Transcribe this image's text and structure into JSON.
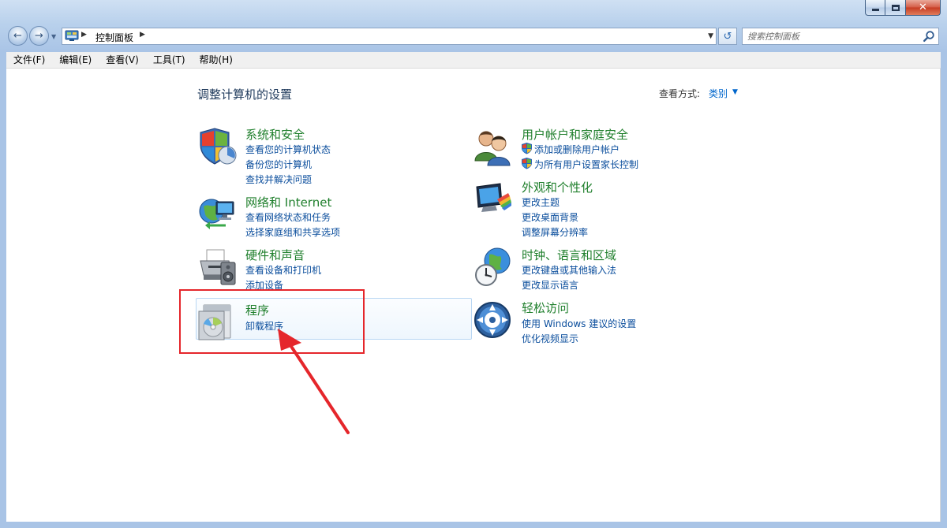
{
  "window": {
    "close_glyph": "✕"
  },
  "nav": {
    "back_glyph": "←",
    "forward_glyph": "→",
    "address": "控制面板",
    "search_placeholder": "搜索控制面板",
    "refresh_glyph": "↺"
  },
  "menu": [
    "文件(F)",
    "编辑(E)",
    "查看(V)",
    "工具(T)",
    "帮助(H)"
  ],
  "page": {
    "title": "调整计算机的设置",
    "view_by_label": "查看方式:",
    "view_by_value": "类别"
  },
  "categories": [
    {
      "title": "系统和安全",
      "links": [
        "查看您的计算机状态",
        "备份您的计算机",
        "查找并解决问题"
      ],
      "icon": "shield-icon"
    },
    {
      "title": "网络和 Internet",
      "links": [
        "查看网络状态和任务",
        "选择家庭组和共享选项"
      ],
      "icon": "network-globe-icon"
    },
    {
      "title": "硬件和声音",
      "links": [
        "查看设备和打印机",
        "添加设备"
      ],
      "icon": "printer-icon"
    },
    {
      "title": "程序",
      "links": [
        "卸载程序"
      ],
      "icon": "programs-icon"
    },
    {
      "title": "用户帐户和家庭安全",
      "links": [
        "添加或删除用户帐户",
        "为所有用户设置家长控制"
      ],
      "icon": "users-icon"
    },
    {
      "title": "外观和个性化",
      "links": [
        "更改主题",
        "更改桌面背景",
        "调整屏幕分辨率"
      ],
      "icon": "monitor-paint-icon"
    },
    {
      "title": "时钟、语言和区域",
      "links": [
        "更改键盘或其他输入法",
        "更改显示语言"
      ],
      "icon": "clock-globe-icon"
    },
    {
      "title": "轻松访问",
      "links": [
        "使用 Windows 建议的设置",
        "优化视频显示"
      ],
      "icon": "ease-of-access-icon"
    }
  ],
  "colors": {
    "category_title": "#1f7f2c",
    "link": "#0a4d9c",
    "highlight": "#e5262b"
  }
}
